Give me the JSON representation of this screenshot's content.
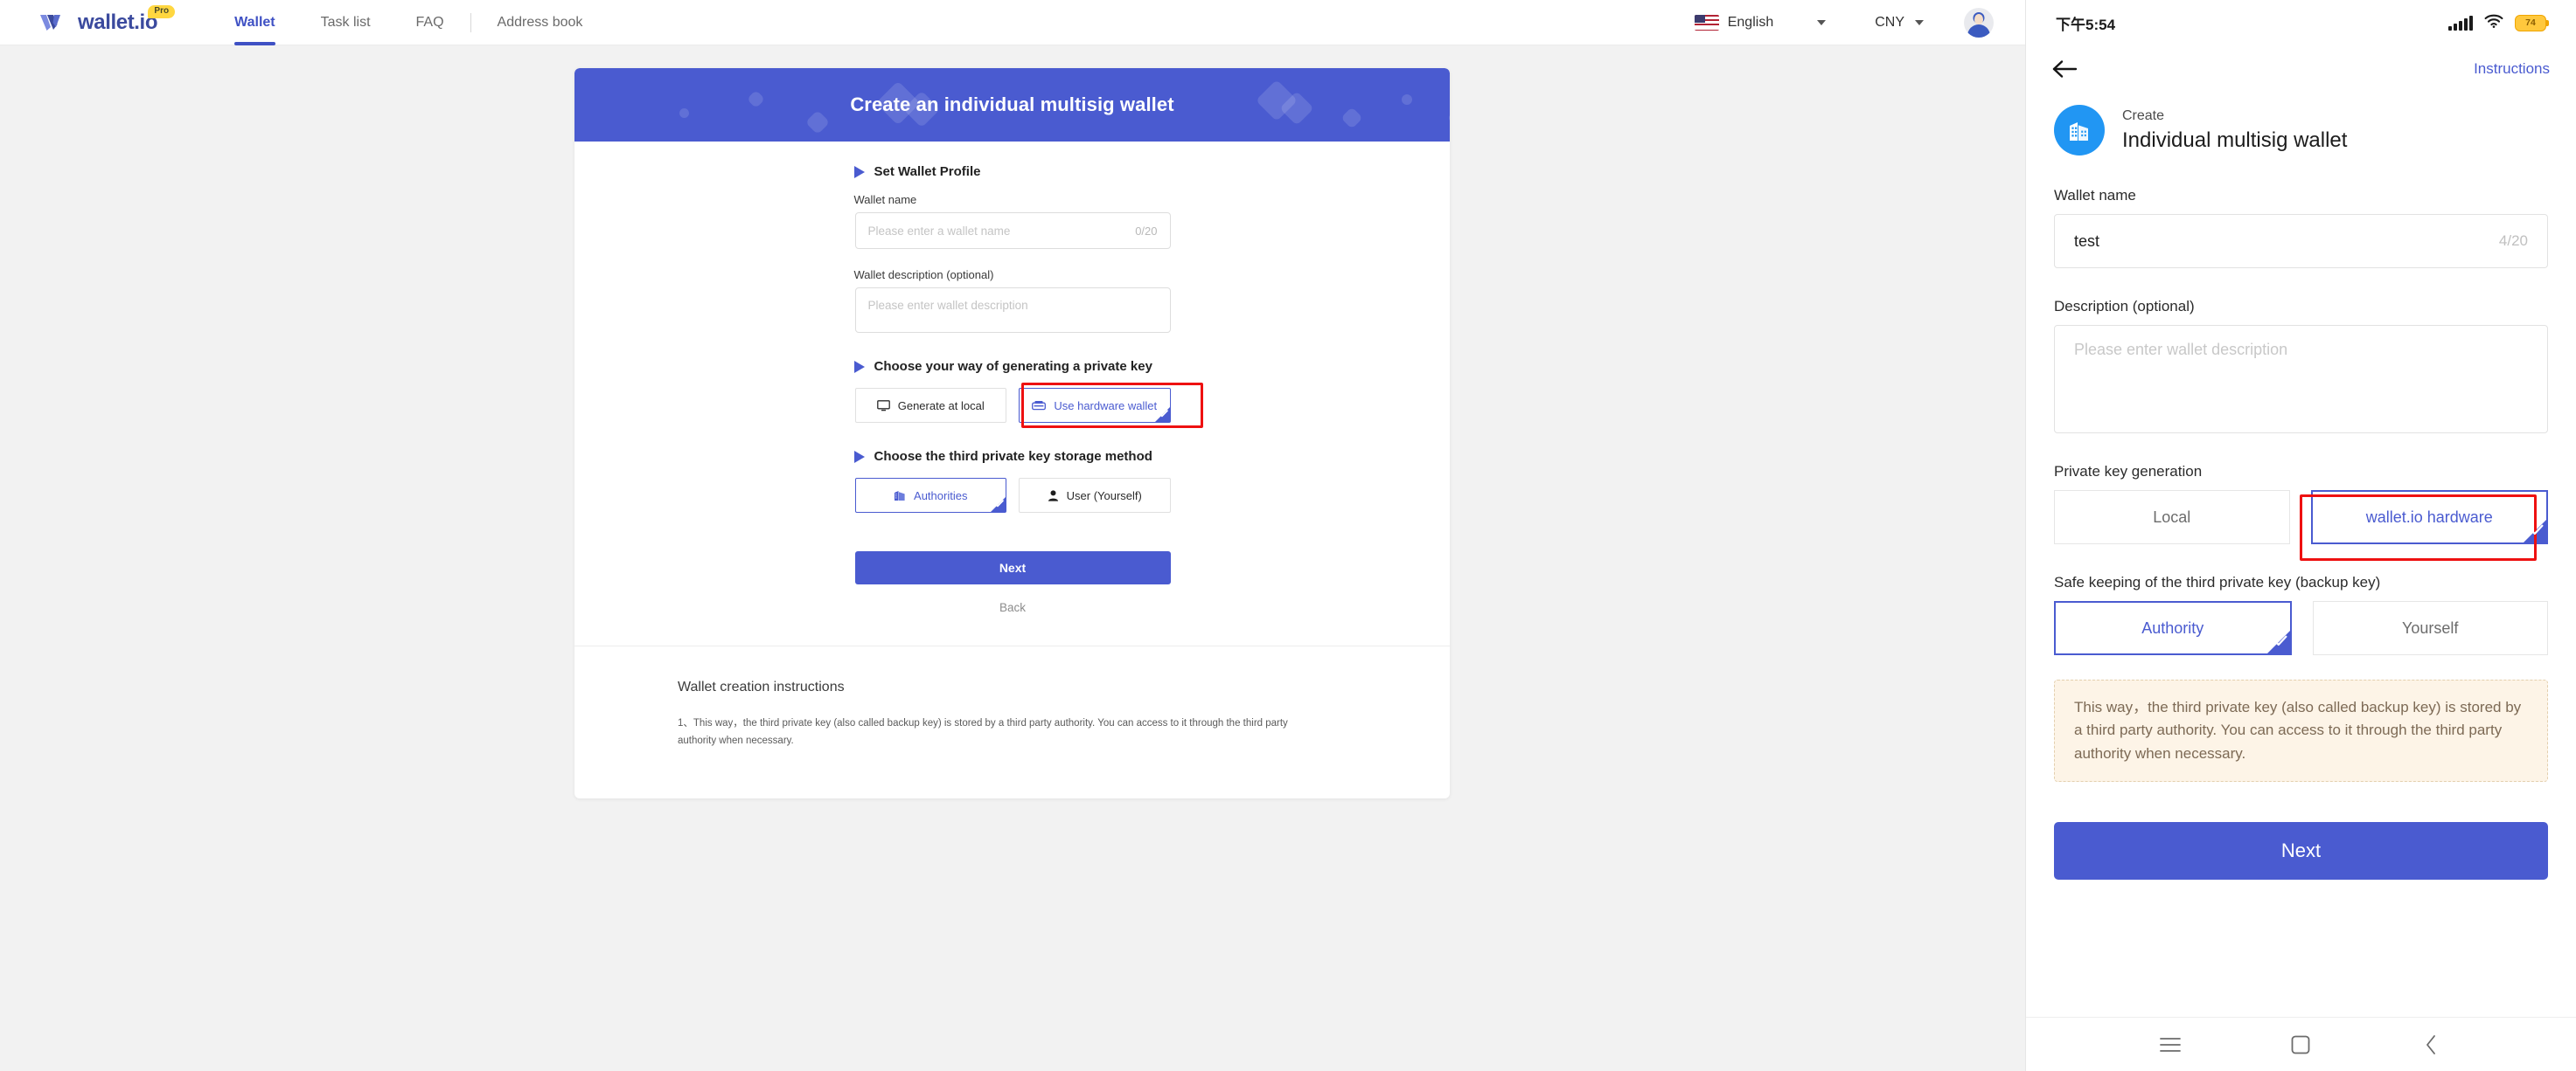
{
  "desktop": {
    "brand": {
      "name": "wallet.io",
      "badge": "Pro"
    },
    "nav": [
      {
        "label": "Wallet",
        "active": true
      },
      {
        "label": "Task list",
        "active": false
      },
      {
        "label": "FAQ",
        "active": false
      },
      {
        "label": "Address book",
        "active": false
      }
    ],
    "language": {
      "label": "English",
      "flag": "us-flag-icon"
    },
    "currency": {
      "label": "CNY"
    },
    "card": {
      "banner_title": "Create an individual multisig wallet",
      "section1_title": "Set Wallet Profile",
      "wallet_name_label": "Wallet name",
      "wallet_name_value": "",
      "wallet_name_placeholder": "Please enter a wallet name",
      "wallet_name_counter": "0/20",
      "wallet_desc_label": "Wallet description (optional)",
      "wallet_desc_value": "",
      "wallet_desc_placeholder": "Please enter wallet description",
      "section2_title": "Choose your way of generating a private key",
      "keygen_options": [
        {
          "label": "Generate at local",
          "icon": "monitor-icon",
          "selected": false
        },
        {
          "label": "Use hardware wallet",
          "icon": "hardware-wallet-icon",
          "selected": true,
          "highlighted": true
        }
      ],
      "section3_title": "Choose the third private key storage method",
      "storage_options": [
        {
          "label": "Authorities",
          "icon": "building-icon",
          "selected": true
        },
        {
          "label": "User (Yourself)",
          "icon": "user-icon",
          "selected": false
        }
      ],
      "next_label": "Next",
      "back_label": "Back",
      "instructions_title": "Wallet creation instructions",
      "instructions_body": "1、This way，the third private key (also called backup key) is stored by a third party authority. You can access to it through the third party authority when necessary."
    }
  },
  "mobile": {
    "statusbar": {
      "time": "下午5:54",
      "battery": "74",
      "signal_icon": "cellular-signal-icon",
      "wifi_icon": "wifi-icon"
    },
    "header": {
      "back_icon": "back-arrow-icon",
      "instructions_label": "Instructions"
    },
    "title": {
      "kicker": "Create",
      "main": "Individual multisig wallet",
      "icon": "building-icon"
    },
    "wallet_name_label": "Wallet name",
    "wallet_name_value": "test",
    "wallet_name_counter": "4/20",
    "description_label": "Description (optional)",
    "description_value": "",
    "description_placeholder": "Please enter wallet description",
    "keygen_label": "Private key generation",
    "keygen_options": [
      {
        "label": "Local",
        "selected": false
      },
      {
        "label": "wallet.io hardware",
        "selected": true,
        "highlighted": true
      }
    ],
    "safekeep_label": "Safe keeping of the third private key (backup key)",
    "safekeep_options": [
      {
        "label": "Authority",
        "selected": true
      },
      {
        "label": "Yourself",
        "selected": false
      }
    ],
    "note": "This way，the third private key (also called backup key) is stored by a third party authority. You can access to it through the third party authority when necessary.",
    "next_label": "Next",
    "navbar": [
      {
        "icon": "menu-icon"
      },
      {
        "icon": "home-square-icon"
      },
      {
        "icon": "back-chevron-icon"
      }
    ]
  },
  "colors": {
    "accent": "#4a5bd0",
    "highlight": "#ee1111",
    "banner": "#4a5bd0",
    "note_bg": "#fdf4e7",
    "mobile_icon": "#2196f3"
  }
}
